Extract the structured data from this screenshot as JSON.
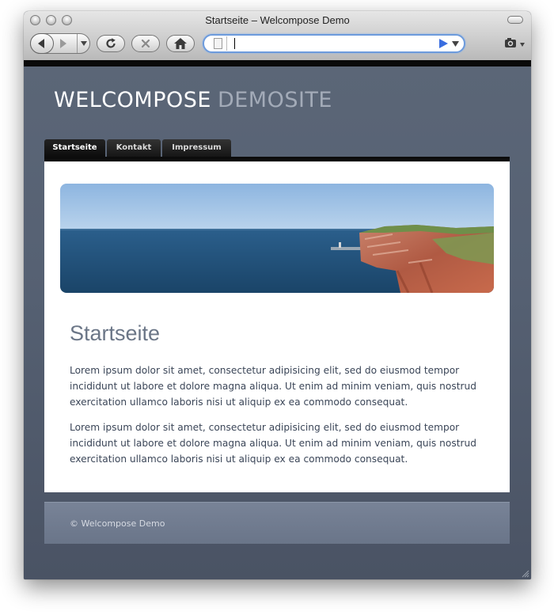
{
  "browser": {
    "window_title": "Startseite – Welcompose Demo",
    "address": {
      "value": "",
      "placeholder": ""
    },
    "icons": {
      "back": "back-arrow-icon",
      "forward": "forward-arrow-icon",
      "history_menu": "chevron-down-icon",
      "reload": "reload-icon",
      "stop": "stop-icon",
      "home": "home-icon",
      "page": "page-icon",
      "go": "go-arrow-icon",
      "address_menu": "chevron-down-icon",
      "snapshot": "camera-icon"
    },
    "colors": {
      "chrome_top": "#e6e6e6",
      "address_focus": "#6d9bdc",
      "go_arrow": "#3a6ee0"
    }
  },
  "site": {
    "title_main": "WELCOMPOSE",
    "title_sub": "DEMOSITE",
    "nav": [
      {
        "label": "Startseite",
        "active": true
      },
      {
        "label": "Kontakt",
        "active": false
      },
      {
        "label": "Impressum",
        "active": false
      }
    ],
    "page": {
      "heading": "Startseite",
      "paragraphs": [
        "Lorem ipsum dolor sit amet, consectetur adipisicing elit, sed do eiusmod tempor incididunt ut labore et dolore magna aliqua. Ut enim ad minim veniam, quis nostrud exercitation ullamco laboris nisi ut aliquip ex ea commodo consequat.",
        "Lorem ipsum dolor sit amet, consectetur adipisicing elit, sed do eiusmod tempor incididunt ut labore et dolore magna aliqua. Ut enim ad minim veniam, quis nostrud exercitation ullamco laboris nisi ut aliquip ex ea commodo consequat."
      ]
    },
    "footer": {
      "copyright": "© Welcompose Demo"
    },
    "colors": {
      "background": "#566173",
      "title_main": "#ffffff",
      "title_sub": "#a3abb8",
      "heading": "#6b7687",
      "body_text": "#3b4658",
      "footer_bg": "#788397",
      "tab_bg": "#161616"
    }
  }
}
